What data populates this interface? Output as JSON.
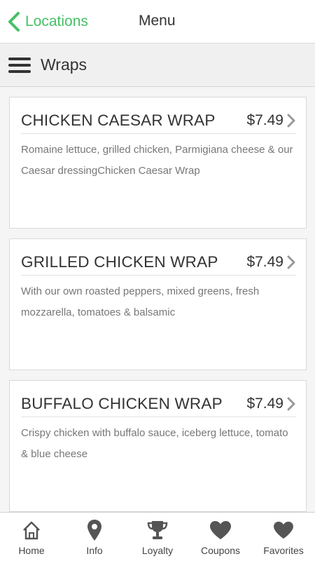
{
  "header": {
    "back_label": "Locations",
    "title": "Menu"
  },
  "category": {
    "title": "Wraps"
  },
  "items": [
    {
      "name": "CHICKEN CAESAR WRAP",
      "price": "$7.49",
      "description": "Romaine lettuce, grilled chicken, Parmigiana cheese & our Caesar dressingChicken Caesar Wrap"
    },
    {
      "name": "GRILLED CHICKEN WRAP",
      "price": "$7.49",
      "description": "With our own roasted peppers, mixed greens, fresh mozzarella, tomatoes & balsamic"
    },
    {
      "name": "BUFFALO CHICKEN WRAP",
      "price": "$7.49",
      "description": "Crispy chicken with buffalo sauce, iceberg lettuce, tomato & blue cheese"
    }
  ],
  "tabs": [
    {
      "label": "Home",
      "icon": "home-icon"
    },
    {
      "label": "Info",
      "icon": "location-pin-icon"
    },
    {
      "label": "Loyalty",
      "icon": "trophy-icon"
    },
    {
      "label": "Coupons",
      "icon": "heart-icon"
    },
    {
      "label": "Favorites",
      "icon": "heart-icon"
    }
  ],
  "colors": {
    "accent": "#45c065",
    "text": "#333333",
    "muted": "#777777"
  }
}
